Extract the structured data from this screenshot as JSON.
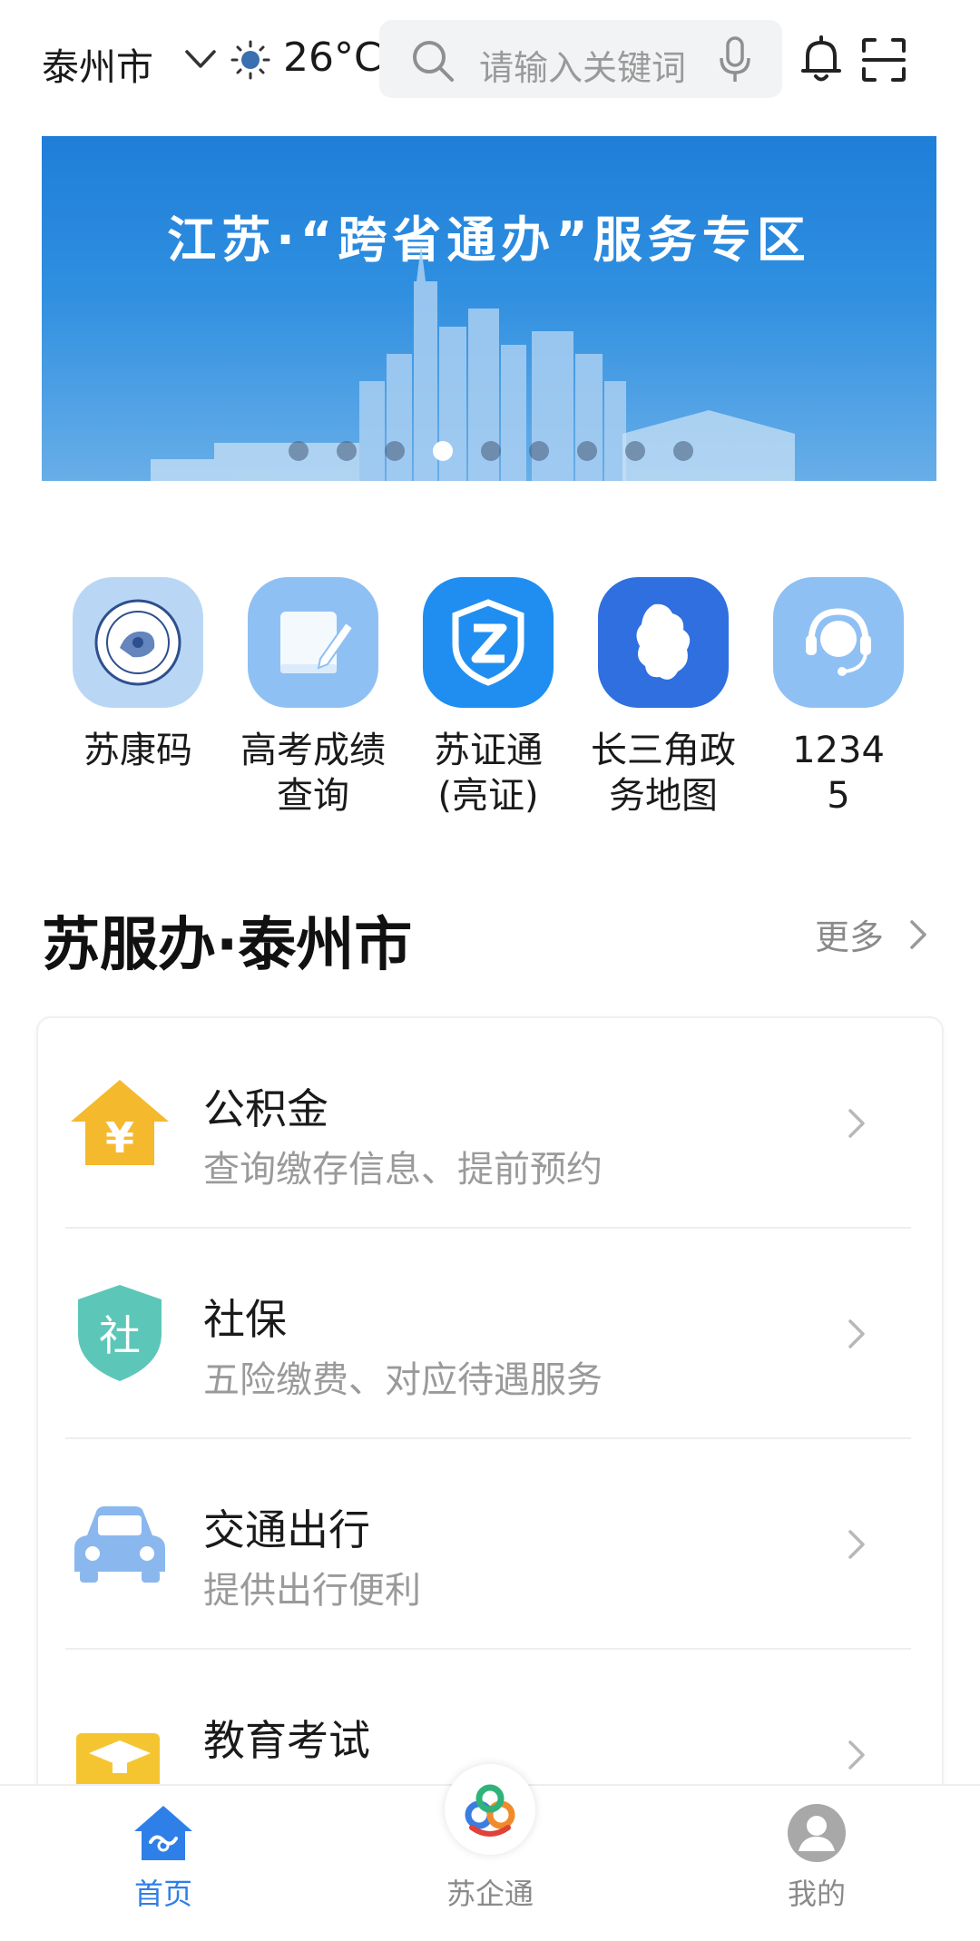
{
  "header": {
    "city": "泰州市",
    "temperature": "26°C",
    "search_placeholder": "请输入关键词"
  },
  "banner": {
    "title": "江苏·“跨省通办”服务专区",
    "slide_count": 9,
    "active_slide": 4
  },
  "quick_services": [
    {
      "label": "苏康码",
      "icon": "health-code-emblem-icon"
    },
    {
      "label": "高考成绩查询",
      "icon": "notebook-pen-icon"
    },
    {
      "label": "苏证通(亮证)",
      "icon": "shield-z-icon"
    },
    {
      "label": "长三角政务地图",
      "icon": "map-region-icon"
    },
    {
      "label": "12345",
      "icon": "headset-icon"
    }
  ],
  "section": {
    "title": "苏服办·泰州市",
    "more_label": "更多"
  },
  "services": [
    {
      "title": "公积金",
      "subtitle": "查询缴存信息、提前预约",
      "icon": "yuan-house-icon"
    },
    {
      "title": "社保",
      "subtitle": "五险缴费、对应待遇服务",
      "icon": "social-security-shield-icon"
    },
    {
      "title": "交通出行",
      "subtitle": "提供出行便利",
      "icon": "car-icon"
    },
    {
      "title": "教育考试",
      "subtitle": "",
      "icon": "graduation-book-icon"
    }
  ],
  "bottom_nav": [
    {
      "label": "首页",
      "icon": "home-icon",
      "active": true
    },
    {
      "label": "苏企通",
      "icon": "suqitong-logo-icon",
      "active": false
    },
    {
      "label": "我的",
      "icon": "user-avatar-icon",
      "active": false
    }
  ],
  "colors": {
    "accent": "#2f7fe8",
    "banner": "#2a86dc",
    "yellow": "#f5b92e",
    "teal": "#5cc7b8",
    "muted": "#9a9a9a"
  }
}
